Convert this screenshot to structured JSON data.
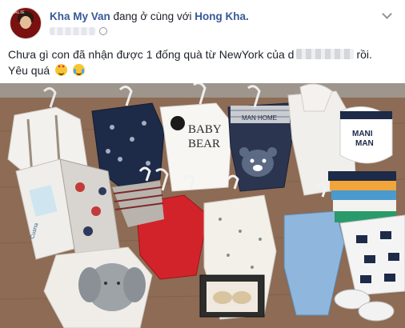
{
  "post": {
    "author": "Kha My Van",
    "connector": " đang ở cùng với ",
    "tagged": "Hong Kha.",
    "avatar_tag": "LALIE",
    "text_line1_before": "Chưa gì con đã nhận được 1 đống quà từ NewYork của d",
    "text_line1_after": "rồi.",
    "text_line2": "Yêu quá",
    "emojis": [
      "heart-eyes",
      "tears-of-joy"
    ]
  },
  "photo": {
    "garment_texts": {
      "baby_bear_line1": "BABY",
      "baby_bear_line2": "BEAR",
      "man_home": "MAN HOME",
      "bib_line1": "MANI",
      "bib_line2": "MAN",
      "box_label": "Cusna"
    }
  },
  "colors": {
    "link_blue": "#385898",
    "text_dark": "#1d2129",
    "wood": "#8b6b55"
  }
}
